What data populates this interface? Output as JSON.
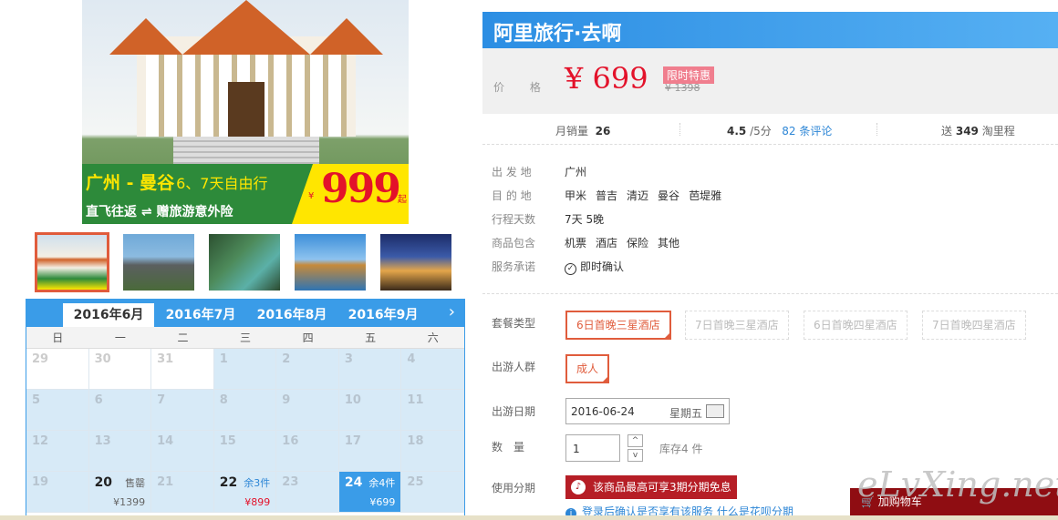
{
  "hero": {
    "route": "广州 - 曼谷",
    "duration": "6、7天自由行",
    "subtitle": "直飞往返 ⇌ 赠旅游意外险",
    "price": "999",
    "yen": "¥",
    "qi": "起"
  },
  "calendar": {
    "months": [
      "2016年6月",
      "2016年7月",
      "2016年8月",
      "2016年9月"
    ],
    "active_month": "2016年6月",
    "weekdays": [
      "日",
      "一",
      "二",
      "三",
      "四",
      "五",
      "六"
    ],
    "cells": [
      {
        "d": "29",
        "style": "white"
      },
      {
        "d": "30",
        "style": "white"
      },
      {
        "d": "31",
        "style": "white"
      },
      {
        "d": "1"
      },
      {
        "d": "2"
      },
      {
        "d": "3"
      },
      {
        "d": "4"
      },
      {
        "d": "5"
      },
      {
        "d": "6"
      },
      {
        "d": "7"
      },
      {
        "d": "8"
      },
      {
        "d": "9"
      },
      {
        "d": "10"
      },
      {
        "d": "11"
      },
      {
        "d": "12"
      },
      {
        "d": "13"
      },
      {
        "d": "14"
      },
      {
        "d": "15"
      },
      {
        "d": "16"
      },
      {
        "d": "17"
      },
      {
        "d": "18"
      },
      {
        "d": "19"
      },
      {
        "d": "20",
        "active": true,
        "tag": "售罄",
        "price": "¥1399"
      },
      {
        "d": "21"
      },
      {
        "d": "22",
        "active": true,
        "tag": "余3件",
        "tagBlue": true,
        "price": "¥899",
        "priceRed": true
      },
      {
        "d": "23"
      },
      {
        "d": "24",
        "active": true,
        "selected": true,
        "tag": "余4件",
        "price": "¥699"
      },
      {
        "d": "25"
      }
    ]
  },
  "product": {
    "title": "阿里旅行·去啊",
    "price_label": "价 格",
    "price": "¥ 699",
    "badge": "限时特惠",
    "original_price": "¥ 1398",
    "sales_label": "月销量",
    "sales": "26",
    "rating": "4.5",
    "rating_suffix": "/5分",
    "reviews": "82 条评论",
    "miles_prefix": "送",
    "miles": "349",
    "miles_suffix": "淘里程"
  },
  "info": [
    {
      "k": "出 发 地",
      "v": [
        "广州"
      ]
    },
    {
      "k": "目 的 地",
      "v": [
        "甲米",
        "普吉",
        "清迈",
        "曼谷",
        "芭堤雅"
      ]
    },
    {
      "k": "行程天数",
      "v": [
        "7天 5晚"
      ]
    },
    {
      "k": "商品包含",
      "v": [
        "机票",
        "酒店",
        "保险",
        "其他"
      ]
    },
    {
      "k": "服务承诺",
      "v": [
        "即时确认"
      ]
    }
  ],
  "options": {
    "package_label": "套餐类型",
    "packages": [
      "6日首晚三星酒店",
      "7日首晚三星酒店",
      "6日首晚四星酒店",
      "7日首晚四星酒店"
    ],
    "people_label": "出游人群",
    "people": "成人",
    "date_label": "出游日期",
    "date": "2016-06-24",
    "weekday": "星期五",
    "qty_label": "数　量",
    "qty": "1",
    "stock": "库存4 件",
    "installment_label": "使用分期",
    "installment_text": "该商品最高可享3期分期免息",
    "note": "登录后确认是否享有该服务 什么是花呗分期",
    "cart": "加购物车"
  },
  "watermark": "eLvXing.net"
}
